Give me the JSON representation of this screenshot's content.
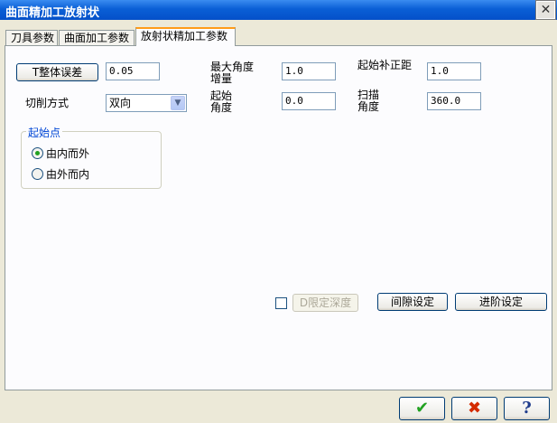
{
  "window": {
    "title": "曲面精加工放射状",
    "close_glyph": "✕"
  },
  "tabs": [
    {
      "label": "刀具参数"
    },
    {
      "label": "曲面加工参数"
    },
    {
      "label": "放射状精加工参数"
    }
  ],
  "params": {
    "total_tolerance_button": "T整体误差",
    "total_tolerance_value": "0.05",
    "max_angle_increment_label": "最大角度增量",
    "max_angle_increment_value": "1.0",
    "start_offset_label": "起始补正距",
    "start_offset_value": "1.0",
    "cut_method_label": "切削方式",
    "cut_method_value": "双向",
    "start_angle_label": "起始角度",
    "start_angle_value": "0.0",
    "sweep_angle_label": "扫描角度",
    "sweep_angle_value": "360.0"
  },
  "start_point": {
    "legend": "起始点",
    "options": [
      {
        "label": "由内而外",
        "checked": true
      },
      {
        "label": "由外而内",
        "checked": false
      }
    ]
  },
  "footer": {
    "limit_depth_label": "D限定深度",
    "gap_settings_label": "间隙设定",
    "advanced_settings_label": "进阶设定"
  },
  "dialog_buttons": {
    "ok_glyph": "✔",
    "cancel_glyph": "✖",
    "help_glyph": "?"
  },
  "colors": {
    "title_bar": "#0a5fd6",
    "ok": "#21a121",
    "cancel": "#d42a00",
    "help": "#1f3c8c",
    "group_legend": "#0046d5"
  }
}
